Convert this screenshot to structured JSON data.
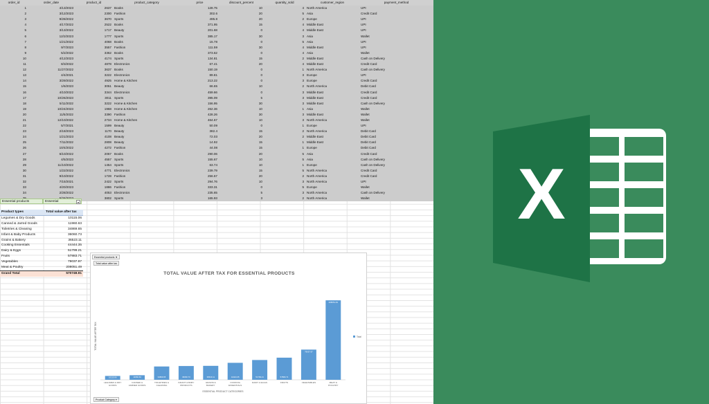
{
  "sheet": {
    "headers": [
      "order_id",
      "order_date",
      "product_id",
      "product_category",
      "price",
      "discount_percent",
      "quantity_sold",
      "customer_region",
      "payment_method"
    ],
    "rows": [
      [
        "1",
        "4/13/2023",
        "2637",
        "Books",
        "128.75",
        "10",
        "4",
        "North America",
        "UPI"
      ],
      [
        "2",
        "3/12/2023",
        "2300",
        "Fashion",
        "302.6",
        "20",
        "5",
        "Asia",
        "Credit Card"
      ],
      [
        "3",
        "9/28/2022",
        "3670",
        "Sports",
        "495.8",
        "20",
        "2",
        "Europe",
        "UPI"
      ],
      [
        "4",
        "4/17/2022",
        "2522",
        "Books",
        "371.95",
        "15",
        "4",
        "Middle East",
        "UPI"
      ],
      [
        "5",
        "3/13/2022",
        "1717",
        "Beauty",
        "201.68",
        "0",
        "4",
        "Middle East",
        "UPI"
      ],
      [
        "6",
        "12/2/2023",
        "1777",
        "Sports",
        "385.17",
        "30",
        "3",
        "Asia",
        "Wallet"
      ],
      [
        "7",
        "1/21/2022",
        "4068",
        "Books",
        "15.78",
        "0",
        "5",
        "Asia",
        "UPI"
      ],
      [
        "8",
        "9/7/2023",
        "3557",
        "Fashion",
        "111.59",
        "30",
        "4",
        "Middle East",
        "UPI"
      ],
      [
        "9",
        "5/2/2022",
        "3362",
        "Books",
        "373.62",
        "0",
        "4",
        "Asia",
        "Wallet"
      ],
      [
        "10",
        "4/12/2023",
        "4174",
        "Sports",
        "134.81",
        "15",
        "2",
        "Middle East",
        "Cash on Delivery"
      ],
      [
        "11",
        "8/3/2022",
        "4878",
        "Electronics",
        "67.41",
        "20",
        "4",
        "Middle East",
        "Credit Card"
      ],
      [
        "12",
        "11/27/2022",
        "3637",
        "Books",
        "150.19",
        "0",
        "1",
        "North America",
        "Cash on Delivery"
      ],
      [
        "13",
        "4/4/2021",
        "3222",
        "Electronics",
        "89.81",
        "0",
        "3",
        "Europe",
        "UPI"
      ],
      [
        "14",
        "3/29/2022",
        "4925",
        "Home & Kitchen",
        "213.22",
        "0",
        "3",
        "Europe",
        "Credit Card"
      ],
      [
        "15",
        "1/6/2023",
        "3051",
        "Beauty",
        "66.65",
        "10",
        "2",
        "North America",
        "Debit Card"
      ],
      [
        "16",
        "4/10/2022",
        "3344",
        "Electronics",
        "459.66",
        "0",
        "3",
        "Middle East",
        "Credit Card"
      ],
      [
        "17",
        "10/26/2023",
        "3011",
        "Sports",
        "395.09",
        "5",
        "3",
        "Middle East",
        "Credit Card"
      ],
      [
        "18",
        "5/11/2022",
        "3222",
        "Home & Kitchen",
        "156.95",
        "30",
        "3",
        "Middle East",
        "Cash on Delivery"
      ],
      [
        "19",
        "10/24/2023",
        "1968",
        "Home & Kitchen",
        "262.36",
        "10",
        "1",
        "Asia",
        "Wallet"
      ],
      [
        "20",
        "11/5/2022",
        "3390",
        "Fashion",
        "428.26",
        "30",
        "3",
        "Middle East",
        "Wallet"
      ],
      [
        "21",
        "12/10/2022",
        "2734",
        "Home & Kitchen",
        "464.67",
        "10",
        "3",
        "North America",
        "Wallet"
      ],
      [
        "22",
        "5/7/2021",
        "1599",
        "Beauty",
        "50.09",
        "0",
        "1",
        "Europe",
        "UPI"
      ],
      [
        "23",
        "2/18/2023",
        "1170",
        "Beauty",
        "382.4",
        "15",
        "2",
        "North America",
        "Debit Card"
      ],
      [
        "24",
        "1/21/2023",
        "4108",
        "Beauty",
        "72.03",
        "20",
        "2",
        "Middle East",
        "Debit Card"
      ],
      [
        "25",
        "7/11/2022",
        "2808",
        "Beauty",
        "14.92",
        "15",
        "1",
        "Middle East",
        "Debit Card"
      ],
      [
        "26",
        "10/4/2022",
        "4272",
        "Fashion",
        "44.08",
        "15",
        "1",
        "Europe",
        "Debit Card"
      ],
      [
        "27",
        "6/10/2022",
        "2067",
        "Books",
        "290.06",
        "20",
        "5",
        "Asia",
        "Credit Card"
      ],
      [
        "28",
        "4/5/2023",
        "4557",
        "Sports",
        "155.67",
        "10",
        "5",
        "Asia",
        "Cash on Delivery"
      ],
      [
        "29",
        "11/10/2022",
        "1454",
        "Sports",
        "63.74",
        "10",
        "1",
        "Europe",
        "Cash on Delivery"
      ],
      [
        "30",
        "1/22/2022",
        "4771",
        "Electronics",
        "239.79",
        "15",
        "5",
        "North America",
        "Credit Card"
      ],
      [
        "31",
        "9/10/2022",
        "1728",
        "Fashion",
        "256.57",
        "20",
        "2",
        "North America",
        "Credit Card"
      ],
      [
        "32",
        "7/15/2021",
        "2422",
        "Sports",
        "294.76",
        "10",
        "3",
        "North America",
        "UPI"
      ],
      [
        "33",
        "4/20/2023",
        "1886",
        "Fashion",
        "333.31",
        "0",
        "5",
        "Europe",
        "Wallet"
      ],
      [
        "34",
        "2/28/2022",
        "4053",
        "Electronics",
        "235.65",
        "5",
        "3",
        "North America",
        "Cash on Delivery"
      ],
      [
        "35",
        "5/26/2023",
        "3802",
        "Sports",
        "165.93",
        "3",
        "2",
        "North America",
        "Wallet"
      ]
    ]
  },
  "filter": {
    "label": "Essential products",
    "value": "Essential"
  },
  "pivot": {
    "header_label": "Product types",
    "header_value": "Total value after tax",
    "rows": [
      [
        "Legumes & Dry Goods",
        "10115.06"
      ],
      [
        "Canned & Jarred Goods",
        "11960.63"
      ],
      [
        "Toiletries & Cleaning",
        "34869.65"
      ],
      [
        "Infant & Baby Products",
        "36060.73"
      ],
      [
        "Grains & Bakery",
        "36523.11"
      ],
      [
        "Cooking Essentials",
        "44444.35"
      ],
      [
        "Dairy & Eggs",
        "51799.21"
      ],
      [
        "Fruits",
        "57883.71"
      ],
      [
        "Vegetables",
        "79037.97"
      ],
      [
        "Meat & Poultry",
        "208051.49"
      ]
    ],
    "total_label": "Grand Total",
    "total_value": "570749.91"
  },
  "chart_buttons": {
    "filter_field": "Essential products",
    "value_field": "Total value after tax",
    "axis_field": "Product Category"
  },
  "chart_data": {
    "type": "bar",
    "title": "TOTAL VALUE AFTER TAX FOR ESSENTIAL PRODUCTS",
    "xlabel": "ESSENTIAL PRODUCT CATEGORIES",
    "ylabel": "TOTAL VALUE AFTER TAX",
    "categories": [
      [
        "LEGUMES & DRY",
        "GOODS"
      ],
      [
        "CANNED &",
        "JARRED GOODS"
      ],
      [
        "TOILETRIES &",
        "CLEANING"
      ],
      [
        "INFANT & BABY",
        "PRODUCTS"
      ],
      [
        "GRAINS &",
        "BAKERY"
      ],
      [
        "COOKING",
        "ESSENTIALS"
      ],
      [
        "DAIRY & EGGS"
      ],
      [
        "FRUITS"
      ],
      [
        "VEGETABLES"
      ],
      [
        "MEAT &",
        "POULTRY"
      ]
    ],
    "series": [
      {
        "name": "Total",
        "values": [
          10115.06,
          11960.63,
          34869.65,
          36060.73,
          36523.11,
          44444.35,
          51799.21,
          57883.71,
          79037.97,
          208051.49
        ],
        "labels": [
          "10115.06",
          "11960.63",
          "34869.65",
          "36060.73",
          "36523.11",
          "44444.35",
          "51799.21",
          "57883.71",
          "79037.97",
          "208051.49"
        ]
      }
    ],
    "ylim": [
      0,
      230000
    ],
    "grid": false,
    "legend": "right",
    "bar_color": "#5b9bd5"
  },
  "logo": {
    "letter": "X",
    "panel_color": "#3a8b5c",
    "dark_color": "#1e7346",
    "sheet_color": "#ffffff"
  }
}
